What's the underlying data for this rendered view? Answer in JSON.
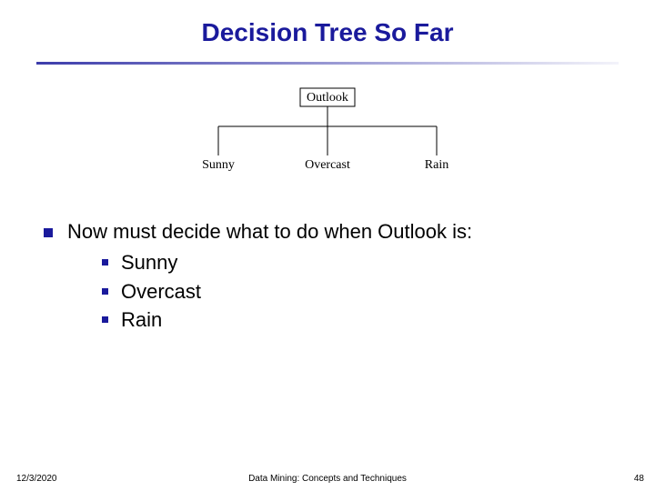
{
  "title": "Decision Tree So Far",
  "tree": {
    "root": "Outlook",
    "children": [
      "Sunny",
      "Overcast",
      "Rain"
    ]
  },
  "body": {
    "lead": "Now must decide what to do when Outlook is:",
    "items": [
      "Sunny",
      "Overcast",
      "Rain"
    ]
  },
  "footer": {
    "date": "12/3/2020",
    "center": "Data Mining: Concepts and Techniques",
    "page": "48"
  }
}
